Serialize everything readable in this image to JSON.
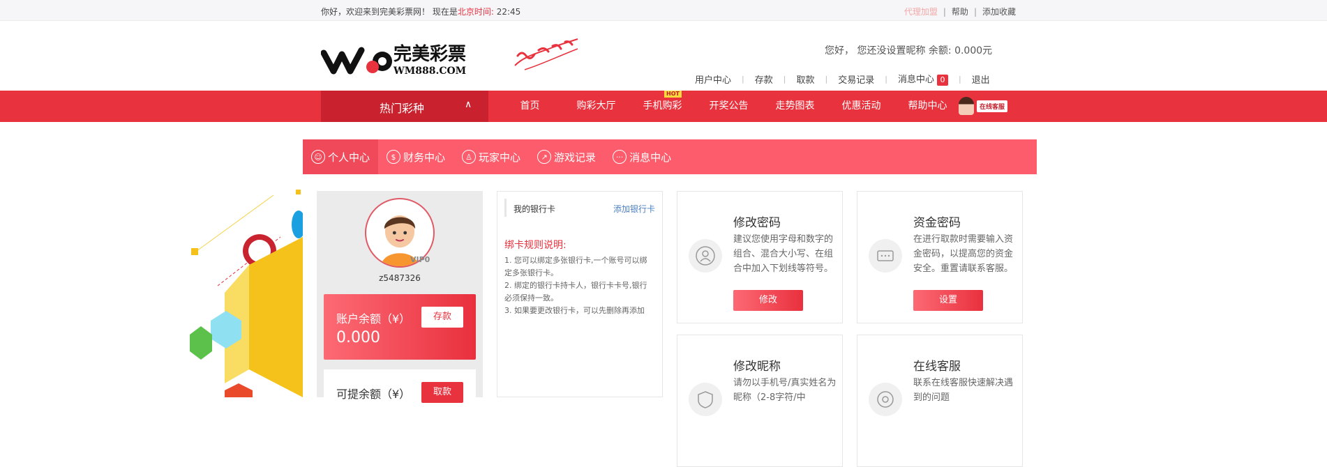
{
  "topbar": {
    "welcome_prefix": "你好，欢迎来到完美彩票网！ 现在是",
    "beijing_time_label": "北京时间:",
    "time": "22:45",
    "links": [
      "代理加盟",
      "帮助",
      "添加收藏"
    ]
  },
  "header": {
    "logo_text": "完美彩票",
    "logo_domain": "WM888.COM",
    "greeting": "您好， 您还没设置昵称 余额: 0.000元",
    "user_nav": [
      "用户中心",
      "存款",
      "取款",
      "交易记录",
      "消息中心",
      "退出"
    ],
    "message_count": "0"
  },
  "nav": {
    "hot_label": "热门彩种",
    "items": [
      "首页",
      "购彩大厅",
      "手机购彩",
      "开奖公告",
      "走势图表",
      "优惠活动",
      "帮助中心"
    ],
    "hot_badge": "HOT",
    "service_tag": "在线客服"
  },
  "subnav": {
    "tabs": [
      "个人中心",
      "财务中心",
      "玩家中心",
      "游戏记录",
      "消息中心"
    ]
  },
  "profile": {
    "vip": "VIP0",
    "username": "z5487326",
    "balance_label": "账户余额（¥）",
    "balance_value": "0.000",
    "deposit_button": "存款",
    "withdraw_label": "可提余额（¥）",
    "withdraw_button": "取款"
  },
  "bank": {
    "title": "我的银行卡",
    "add_link": "添加银行卡",
    "rules_title": "绑卡规则说明:",
    "rules": [
      "1. 您可以绑定多张银行卡,一个账号可以绑定多张银行卡。",
      "2. 绑定的银行卡持卡人，银行卡卡号,银行必须保持一致。",
      "3. 如果要更改银行卡，可以先删除再添加"
    ]
  },
  "cards": [
    {
      "title": "修改密码",
      "desc": "建议您使用字母和数字的组合、混合大小写、在组合中加入下划线等符号。",
      "button": "修改",
      "icon": "user-icon"
    },
    {
      "title": "资金密码",
      "desc": "在进行取款时需要输入资金密码，以提高您的资金安全。重置请联系客服。",
      "button": "设置",
      "icon": "password-dots-icon"
    },
    {
      "title": "修改昵称",
      "desc": "请勿以手机号/真实姓名为昵称（2-8字符/中",
      "button": "",
      "icon": "shield-icon"
    },
    {
      "title": "在线客服",
      "desc": "联系在线客服快速解决遇到的问题",
      "button": "",
      "icon": "service-icon"
    }
  ],
  "colors": {
    "brand_red": "#e8323e",
    "subnav_pink": "#fc5c6b",
    "link_blue": "#4a7fc1"
  }
}
